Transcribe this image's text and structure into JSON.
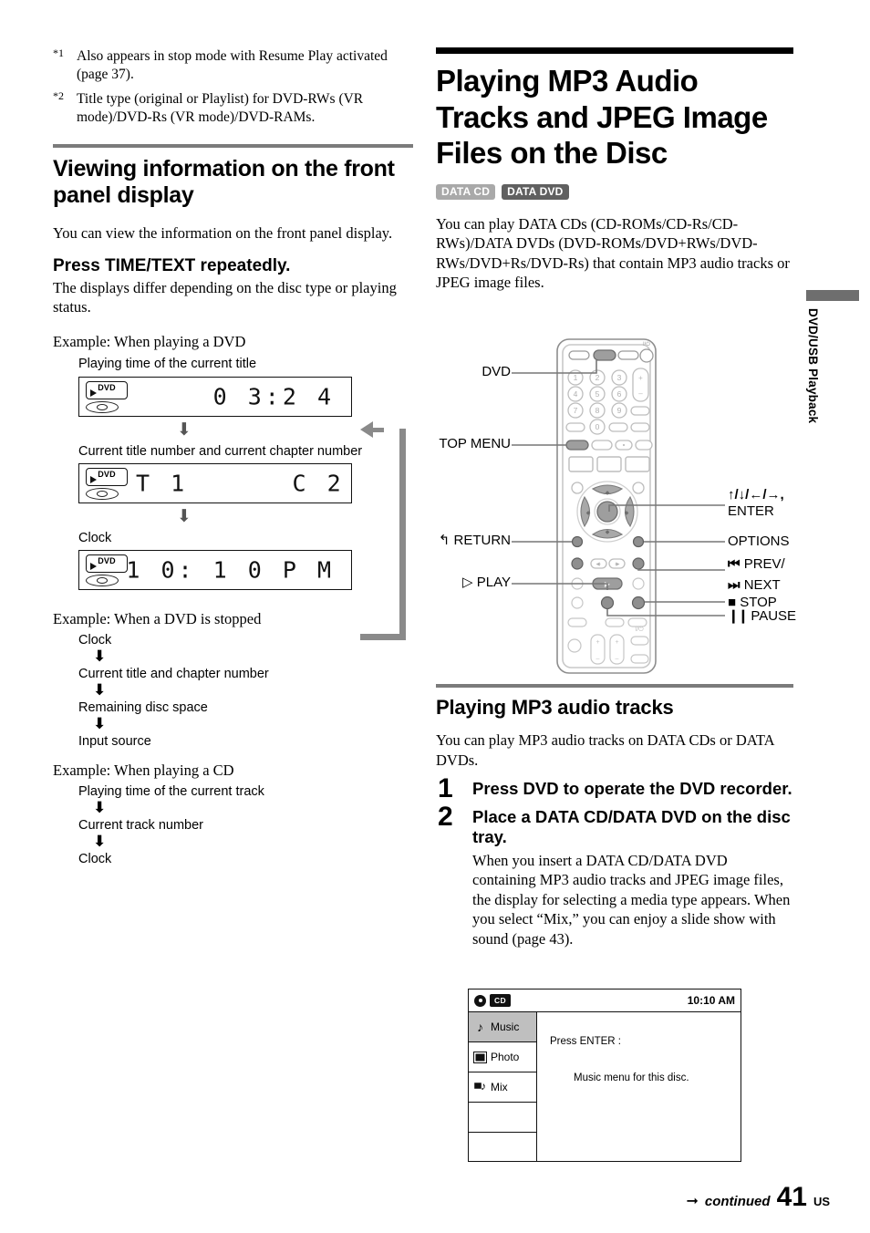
{
  "footnotes": [
    {
      "mark": "*1",
      "text": "Also appears in stop mode with Resume Play activated (page 37)."
    },
    {
      "mark": "*2",
      "text": "Title type (original or Playlist) for DVD-RWs (VR mode)/DVD-Rs (VR mode)/DVD-RAMs."
    }
  ],
  "left": {
    "section_heading": "Viewing information on the front panel display",
    "intro": "You can view the information on the front panel display.",
    "instruction": "Press TIME/TEXT repeatedly.",
    "instruction_body": "The displays differ depending on the disc type or playing status.",
    "example_dvd_label": "Example: When playing a DVD",
    "flow_dvd": [
      {
        "caption": "Playing time of the current title",
        "indicator": "DVD",
        "segments": "0 3:2 4",
        "align": "right"
      },
      {
        "caption": "Current title number and current chapter number",
        "indicator": "DVD",
        "segments": "T 1      C 2",
        "align": "left"
      },
      {
        "caption": "Clock",
        "indicator": "DVD",
        "segments": "1 0: 1 0 P M",
        "align": "right"
      }
    ],
    "example_stopped_label": "Example: When a DVD is stopped",
    "flow_stopped": [
      "Clock",
      "Current title and chapter number",
      "Remaining disc space",
      "Input source"
    ],
    "example_cd_label": "Example: When playing a CD",
    "flow_cd": [
      "Playing time of the current track",
      "Current track number",
      "Clock"
    ]
  },
  "right": {
    "main_heading": "Playing MP3 Audio Tracks and JPEG Image Files on the Disc",
    "badges": [
      {
        "label": "DATA CD",
        "tone": "light",
        "color": "#a9a9a9"
      },
      {
        "label": "DATA DVD",
        "tone": "dark",
        "color": "#606060"
      }
    ],
    "intro": "You can play DATA CDs (CD-ROMs/CD-Rs/CD-RWs)/DATA DVDs (DVD-ROMs/DVD+RWs/DVD-RWs/DVD+Rs/DVD-Rs) that contain MP3 audio tracks or JPEG image files.",
    "sub_heading": "Playing MP3 audio tracks",
    "sub_intro": "You can play MP3 audio tracks on DATA CDs or DATA DVDs.",
    "steps": [
      {
        "num": "1",
        "head": "Press DVD to operate the DVD recorder.",
        "text": ""
      },
      {
        "num": "2",
        "head": "Place a DATA CD/DATA DVD on the disc tray.",
        "text": "When you insert a DATA CD/DATA DVD containing MP3 audio tracks and JPEG image files, the display for selecting a media type appears. When you select “Mix,” you can enjoy a slide show with sound (page 43)."
      }
    ]
  },
  "remote": {
    "callouts_left": [
      {
        "key": "dvd",
        "label": "DVD"
      },
      {
        "key": "top_menu",
        "label": "TOP MENU"
      },
      {
        "key": "return",
        "label": "RETURN",
        "icon": "return-arrow-icon"
      },
      {
        "key": "play",
        "label": "PLAY",
        "icon": "play-triangle-icon"
      }
    ],
    "callouts_right": [
      {
        "key": "enter",
        "line1": "↑/↓/←/→,",
        "line2": "ENTER"
      },
      {
        "key": "options",
        "label": "OPTIONS"
      },
      {
        "key": "prev",
        "label": "PREV/",
        "icon": "prev-icon"
      },
      {
        "key": "next",
        "label": "NEXT",
        "icon": "next-icon"
      },
      {
        "key": "stop",
        "label": "STOP",
        "icon": "stop-square-icon"
      },
      {
        "key": "pause",
        "label": "PAUSE",
        "icon": "pause-bars-icon"
      }
    ],
    "keypad": [
      "1",
      "2",
      "3",
      "4",
      "5",
      "6",
      "7",
      "8",
      "9",
      "0"
    ],
    "power_symbol": "I/⏻"
  },
  "osd": {
    "cd_chip": "CD",
    "time": "10:10 AM",
    "menu_items": [
      {
        "label": "Music",
        "icon": "music-note-icon",
        "selected": true
      },
      {
        "label": "Photo",
        "icon": "photo-square-icon",
        "selected": false
      },
      {
        "label": "Mix",
        "icon": "mix-icon",
        "selected": false
      }
    ],
    "press_enter": "Press ENTER :",
    "message": "Music menu for this disc."
  },
  "side_tab": {
    "label": "DVD/USB Playback"
  },
  "footer": {
    "continued": "continued",
    "page": "41",
    "region": "US"
  }
}
